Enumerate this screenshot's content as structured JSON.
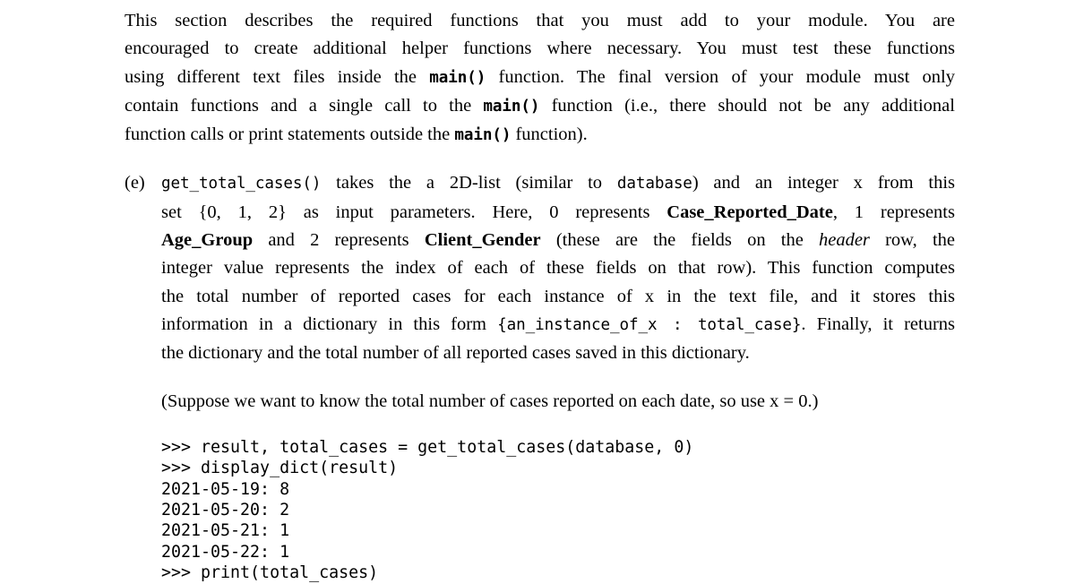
{
  "document": {
    "background_color": "#ffffff",
    "text_color": "#000000"
  },
  "intro_paragraph": {
    "name": "intro-paragraph",
    "lines": [
      {
        "id": "intro-line-1",
        "runs": [
          {
            "t": "This section describes the required functions that you must add to your module. You are",
            "s": "normal"
          }
        ]
      },
      {
        "id": "intro-line-2",
        "runs": [
          {
            "t": "encouraged to create additional helper functions where necessary. You must test these functions",
            "s": "normal"
          }
        ]
      },
      {
        "id": "intro-line-3",
        "runs": [
          {
            "t": "using different text files inside the ",
            "s": "normal"
          },
          {
            "t": "main()",
            "s": "mono-bold"
          },
          {
            "t": " function. The final version of your module must only",
            "s": "normal"
          }
        ]
      },
      {
        "id": "intro-line-4",
        "runs": [
          {
            "t": "contain functions and a single call to the ",
            "s": "normal"
          },
          {
            "t": "main()",
            "s": "mono-bold"
          },
          {
            "t": " function (i.e., there should not be any additional",
            "s": "normal"
          }
        ]
      },
      {
        "id": "intro-line-5",
        "runs": [
          {
            "t": "function calls or print statements outside the ",
            "s": "normal"
          },
          {
            "t": "main()",
            "s": "mono-bold"
          },
          {
            "t": " function).",
            "s": "normal"
          }
        ]
      }
    ]
  },
  "item_e": {
    "name": "list-item-e",
    "marker": "(e)",
    "lines": [
      {
        "id": "item-e-line-1",
        "runs": [
          {
            "t": "get_total_cases()",
            "s": "mono"
          },
          {
            "t": "  takes the a 2D-list (similar to ",
            "s": "normal"
          },
          {
            "t": "database",
            "s": "mono"
          },
          {
            "t": ") and an integer x from this",
            "s": "normal"
          }
        ]
      },
      {
        "id": "item-e-line-2",
        "runs": [
          {
            "t": "set {0, 1, 2} as input parameters. Here, 0 represents ",
            "s": "normal"
          },
          {
            "t": "Case_Reported_Date",
            "s": "bold"
          },
          {
            "t": ", 1 represents",
            "s": "normal"
          }
        ]
      },
      {
        "id": "item-e-line-3",
        "runs": [
          {
            "t": "Age_Group",
            "s": "bold"
          },
          {
            "t": " and 2 represents ",
            "s": "normal"
          },
          {
            "t": "Client_Gender",
            "s": "bold"
          },
          {
            "t": " (these are the fields on the ",
            "s": "normal"
          },
          {
            "t": "header",
            "s": "italic"
          },
          {
            "t": " row, the",
            "s": "normal"
          }
        ]
      },
      {
        "id": "item-e-line-4",
        "runs": [
          {
            "t": "integer value represents the index of each of these fields on that row). This function computes",
            "s": "normal"
          }
        ]
      },
      {
        "id": "item-e-line-5",
        "runs": [
          {
            "t": "the total number of reported cases for each instance of x in the text file, and it stores this",
            "s": "normal"
          }
        ]
      },
      {
        "id": "item-e-line-6",
        "runs": [
          {
            "t": "information in a dictionary in this form ",
            "s": "normal"
          },
          {
            "t": "{an_instance_of_x : total_case}",
            "s": "mono"
          },
          {
            "t": ". Finally, it returns",
            "s": "normal"
          }
        ]
      },
      {
        "id": "item-e-line-7",
        "runs": [
          {
            "t": "the dictionary and the total number of all reported cases saved in this dictionary.",
            "s": "normal"
          }
        ]
      }
    ]
  },
  "note": {
    "name": "suppose-note",
    "text": "(Suppose we want to know the total number of cases reported on each date, so use x = 0.)"
  },
  "console": {
    "name": "console-transcript",
    "prompt": ">>>",
    "lines": [
      ">>> result, total_cases = get_total_cases(database, 0)",
      ">>> display_dict(result)",
      "2021-05-19: 8",
      "2021-05-20: 2",
      "2021-05-21: 1",
      "2021-05-22: 1",
      ">>> print(total_cases)"
    ],
    "output_pairs": [
      {
        "date": "2021-05-19",
        "count": "8"
      },
      {
        "date": "2021-05-20",
        "count": "2"
      },
      {
        "date": "2021-05-21",
        "count": "1"
      },
      {
        "date": "2021-05-22",
        "count": "1"
      }
    ]
  }
}
